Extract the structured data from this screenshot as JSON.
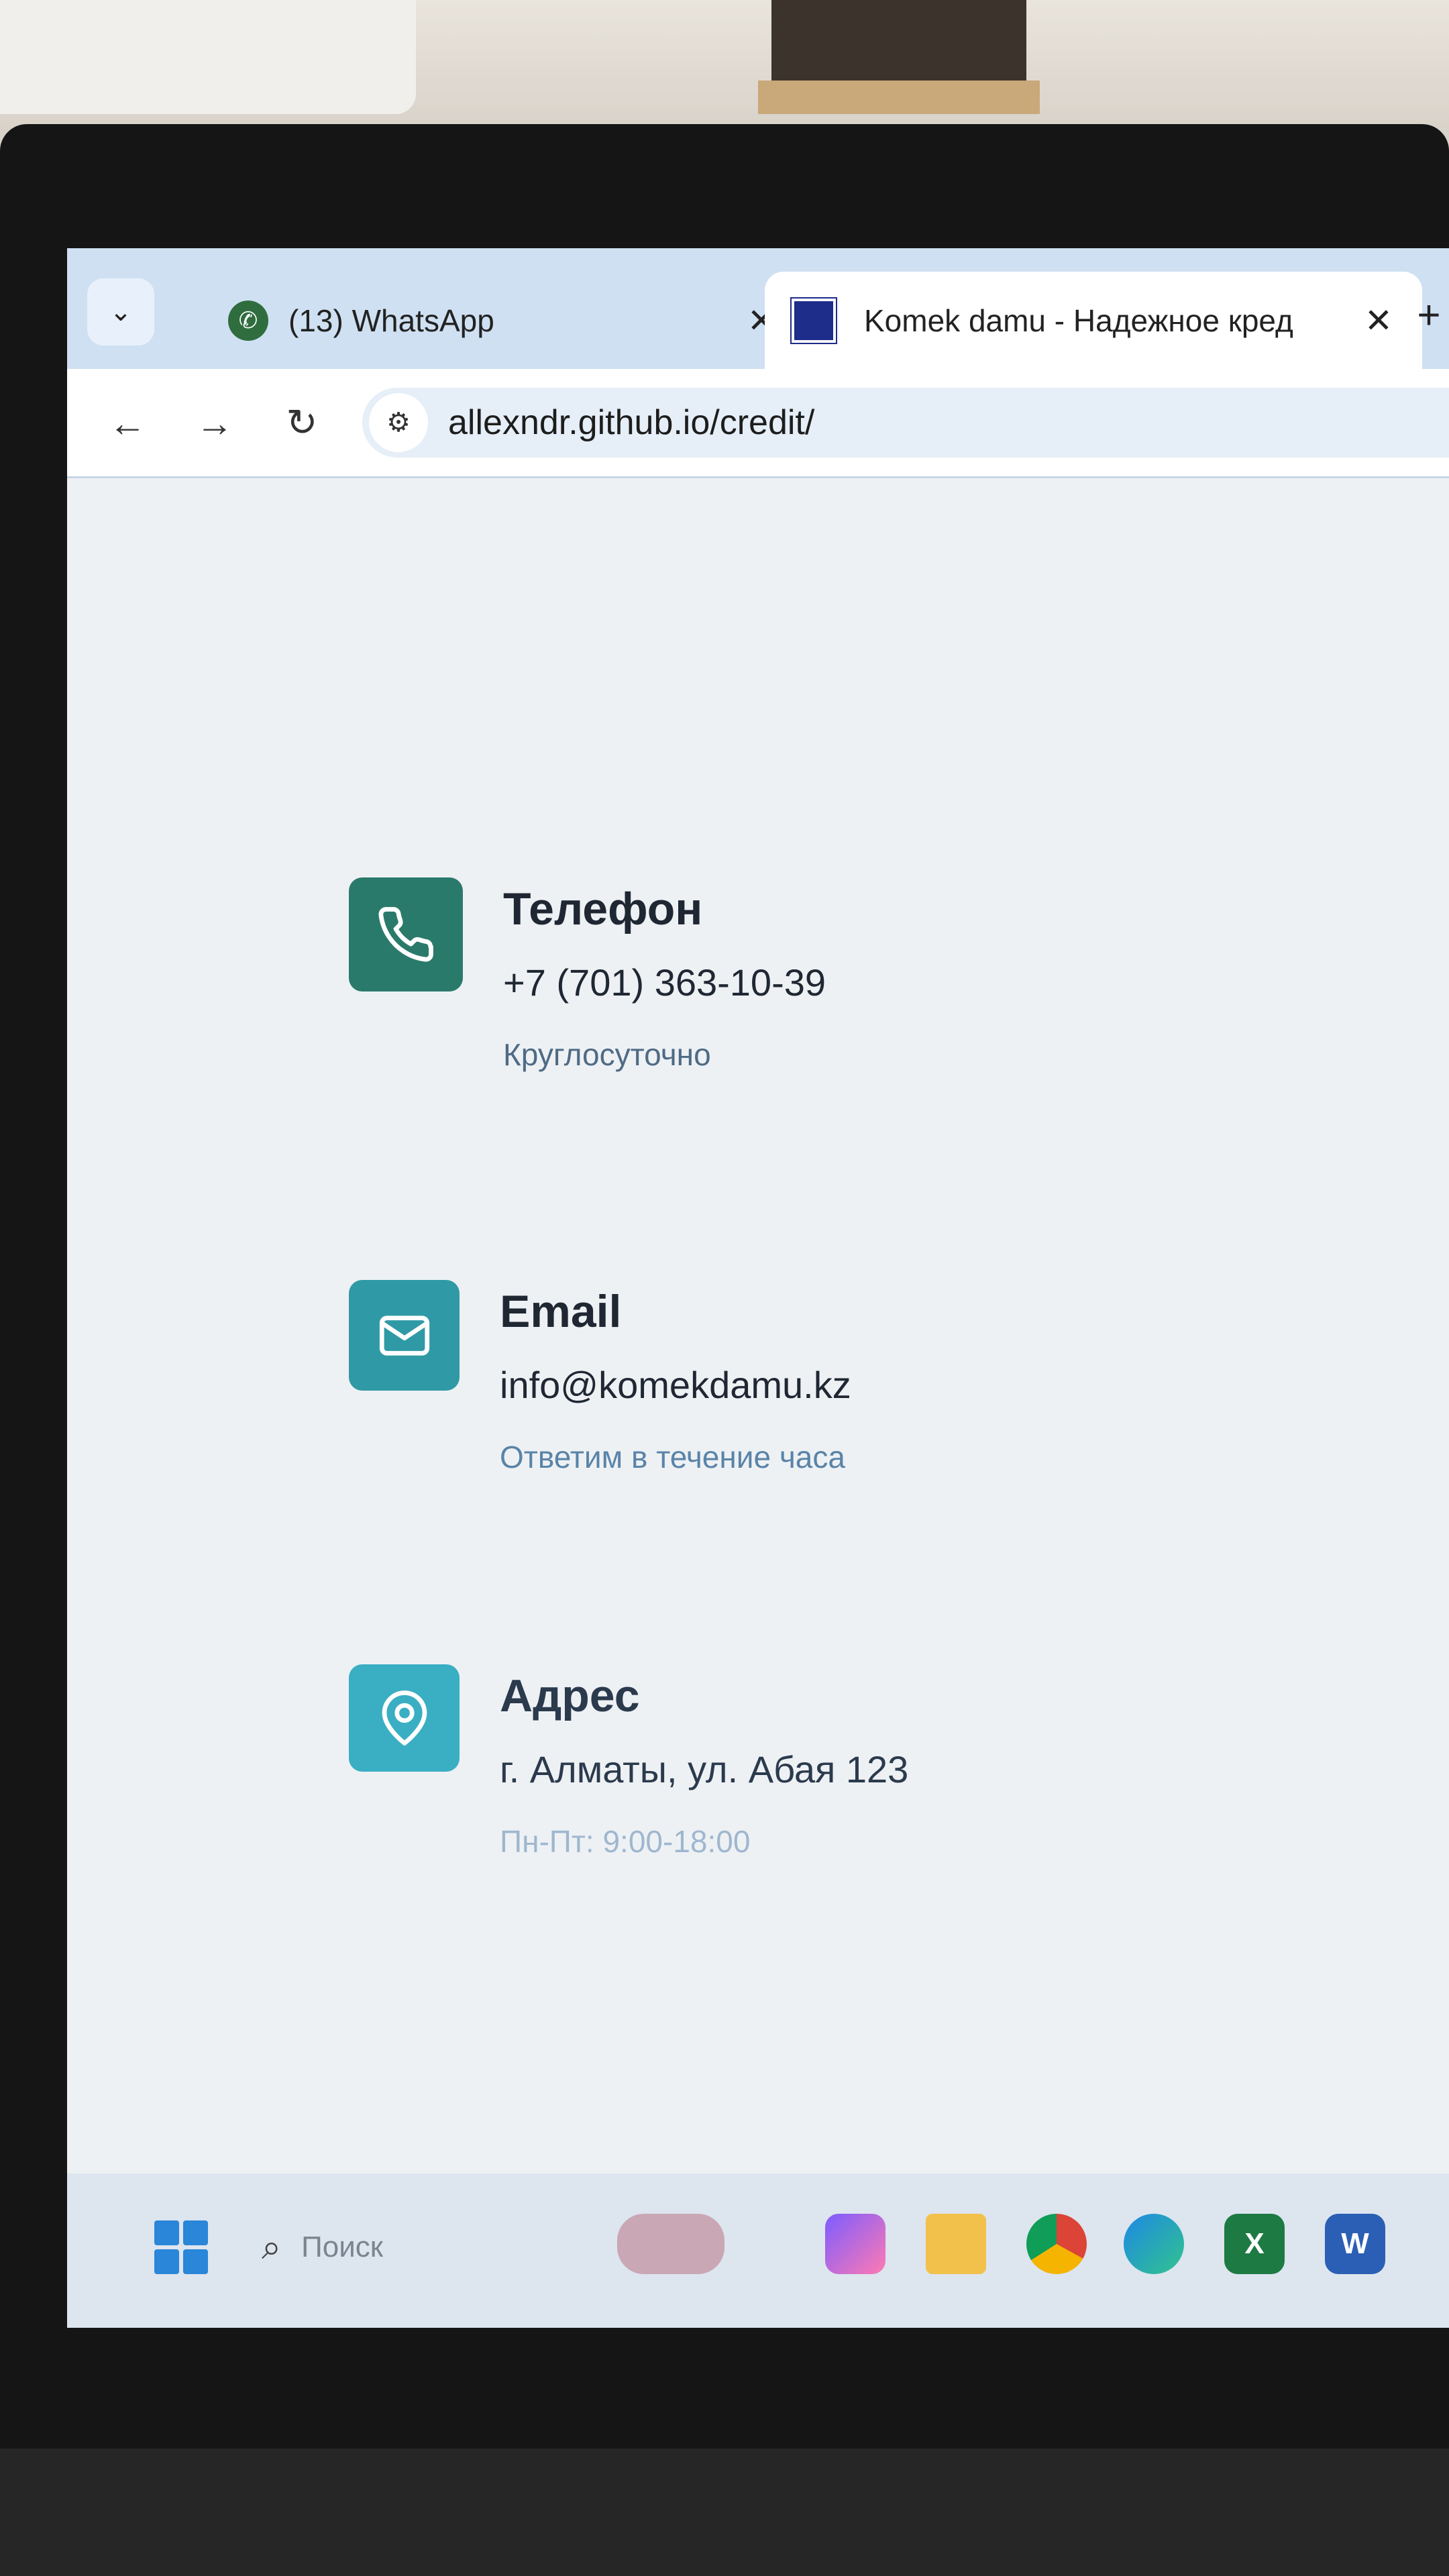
{
  "browser": {
    "tabs": [
      {
        "title": "(13) WhatsApp",
        "active": false,
        "icon": "whatsapp-icon"
      },
      {
        "title": "Komek damu - Надежное кред",
        "active": true,
        "icon": "site-favicon"
      }
    ],
    "url": "allexndr.github.io/credit/"
  },
  "contacts": [
    {
      "icon": "phone-icon",
      "title": "Телефон",
      "value": "+7 (701) 363-10-39",
      "note": "Круглосуточно",
      "color": "#2a7a6b"
    },
    {
      "icon": "mail-icon",
      "title": "Email",
      "value": "info@komekdamu.kz",
      "note": "Ответим в течение часа",
      "color": "#2f9aa5"
    },
    {
      "icon": "location-pin-icon",
      "title": "Адрес",
      "value": "г. Алматы, ул. Абая 123",
      "note": "Пн-Пт: 9:00-18:00",
      "color": "#3aaec3"
    }
  ],
  "taskbar": {
    "search_placeholder": "Поиск",
    "apps": [
      "windows-start-icon",
      "copilot-icon",
      "file-explorer-icon",
      "chrome-icon",
      "edge-icon",
      "excel-icon",
      "word-icon"
    ]
  },
  "colors": {
    "title_text": "#1f2733",
    "note_text": "#4f6b85",
    "tabstrip": "#cfe0f2"
  }
}
